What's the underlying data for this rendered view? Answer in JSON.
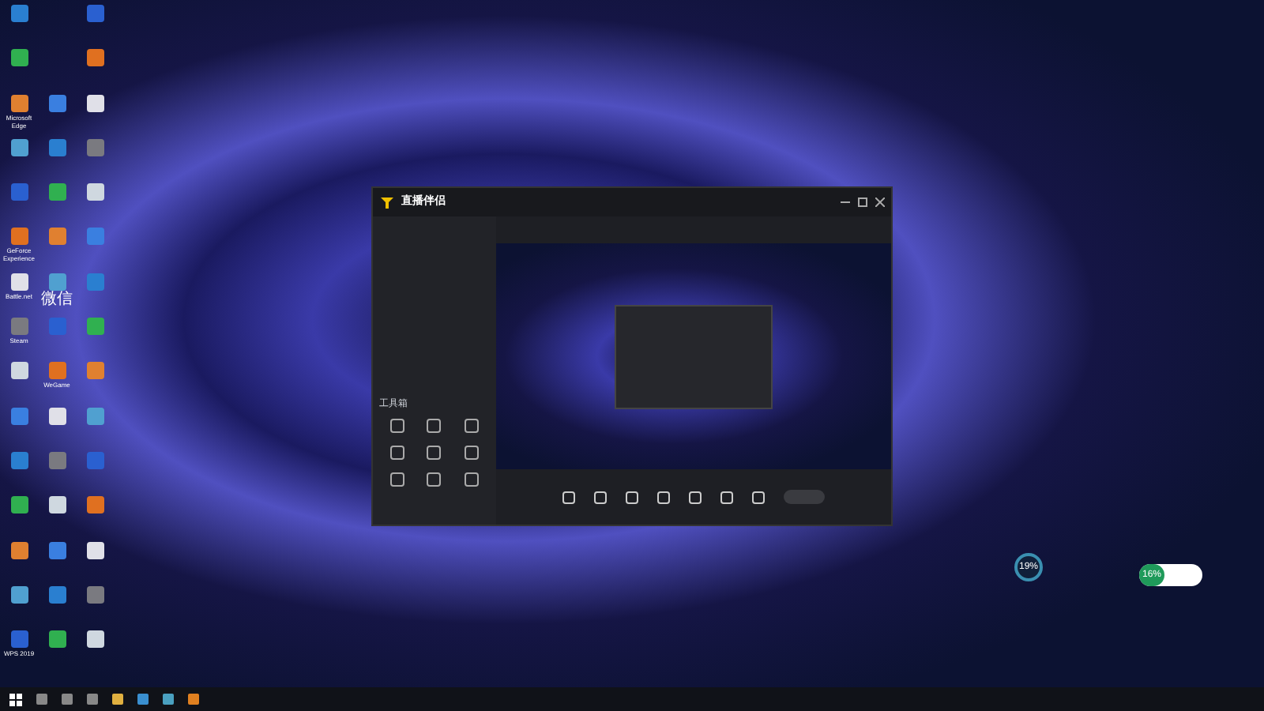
{
  "desktop_icons": [
    {
      "label": "Microsoft Edge"
    },
    {
      "label": "GeForce Experience"
    },
    {
      "label": "Battle.net"
    },
    {
      "label": "微信"
    },
    {
      "label": "Steam"
    },
    {
      "label": "WeGame"
    },
    {
      "label": "WPS 2019"
    }
  ],
  "app_window": {
    "title": "直播伴侣",
    "toolbox_title": "工具箱"
  },
  "widgets": {
    "cpu": "19%",
    "memory": "16%"
  }
}
